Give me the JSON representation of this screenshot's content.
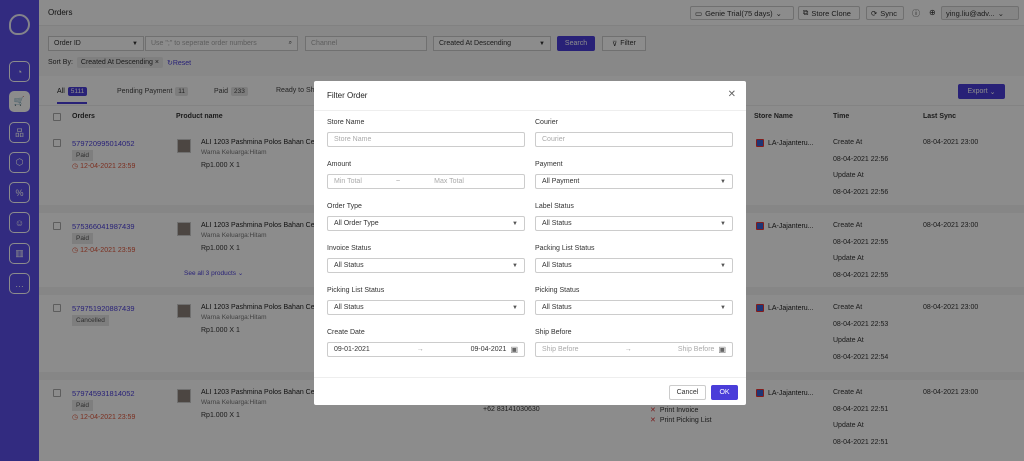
{
  "topbar": {
    "title": "Orders",
    "trial": "Genie Trial(75 days)",
    "store_clone": "Store Clone",
    "sync": "Sync",
    "user": "ying.liu@adv..."
  },
  "filterbar": {
    "search_type": "Order ID",
    "search_placeholder": "Use \";\" to seperate order numbers",
    "channel_placeholder": "Channel",
    "sort_select": "Created At Descending",
    "search_label": "Search",
    "filter_label": "Filter",
    "sort_by_label": "Sort By:",
    "sort_chip": "Created At Descending",
    "chip_close": "×",
    "reset_label": "Reset"
  },
  "tabs": [
    {
      "label": "All",
      "count": "5111"
    },
    {
      "label": "Pending Payment",
      "count": "11"
    },
    {
      "label": "Paid",
      "count": "233"
    },
    {
      "label": "Ready to Shi",
      "count": ""
    }
  ],
  "export_label": "Export",
  "table": {
    "headers": {
      "orders": "Orders",
      "product": "Product name",
      "store": "Store Name",
      "time": "Time",
      "last_sync": "Last Sync"
    },
    "rows": [
      {
        "order_id": "579720995014052",
        "status": "Paid",
        "deadline": "12-04-2021 23:59",
        "product": "ALI 1203 Pashmina Polos Bahan Cer...",
        "variant": "Warna Keluarga:Hitam",
        "price": "Rp1.000 X 1",
        "store": "LA-Jajanteru...",
        "create_label": "Create At",
        "create_at": "08-04-2021 22:56",
        "update_label": "Update At",
        "update_at": "08-04-2021 22:56",
        "last_sync": "08-04-2021 23:00"
      },
      {
        "order_id": "575366041987439",
        "status": "Paid",
        "deadline": "12-04-2021 23:59",
        "product": "ALI 1203 Pashmina Polos Bahan Cer...",
        "variant": "Warna Keluarga:Hitam",
        "price": "Rp1.000 X 1",
        "see_all": "See all 3 products",
        "store": "LA-Jajanteru...",
        "create_label": "Create At",
        "create_at": "08-04-2021 22:55",
        "update_label": "Update At",
        "update_at": "08-04-2021 22:55",
        "last_sync": "08-04-2021 23:00"
      },
      {
        "order_id": "579751920887439",
        "status": "Cancelled",
        "product": "ALI 1203 Pashmina Polos Bahan Cer...",
        "variant": "Warna Keluarga:Hitam",
        "price": "Rp1.000 X 1",
        "store": "LA-Jajanteru...",
        "create_label": "Create At",
        "create_at": "08-04-2021 22:53",
        "update_label": "Update At",
        "update_at": "08-04-2021 22:54",
        "last_sync": "08-04-2021 23:00"
      },
      {
        "order_id": "579745931814052",
        "status": "Paid",
        "deadline": "12-04-2021 23:59",
        "product": "ALI 1203 Pashmina Polos Bahan Cer...",
        "variant": "Warna Keluarga:Hitam",
        "price": "Rp1.000 X 1",
        "phone": "+62 83141030630",
        "print_invoice": "Print Invoice",
        "print_picking": "Print Picking List",
        "store": "LA-Jajanteru...",
        "create_label": "Create At",
        "create_at": "08-04-2021 22:51",
        "update_label": "Update At",
        "update_at": "08-04-2021 22:51",
        "last_sync": "08-04-2021 23:00"
      }
    ]
  },
  "modal": {
    "title": "Filter Order",
    "store_name_label": "Store Name",
    "store_name_placeholder": "Store Name",
    "courier_label": "Courier",
    "courier_placeholder": "Courier",
    "amount_label": "Amount",
    "min_placeholder": "Min Total",
    "max_placeholder": "Max Total",
    "range_sep": "~",
    "payment_label": "Payment",
    "payment_value": "All Payment",
    "order_type_label": "Order Type",
    "order_type_value": "All Order Type",
    "label_status_label": "Label Status",
    "label_status_value": "All Status",
    "invoice_status_label": "Invoice Status",
    "invoice_status_value": "All Status",
    "packing_list_label": "Packing List Status",
    "packing_list_value": "All Status",
    "picking_list_label": "Picking List Status",
    "picking_list_value": "All Status",
    "picking_status_label": "Picking Status",
    "picking_status_value": "All Status",
    "create_date_label": "Create Date",
    "create_date_from": "09-01-2021",
    "create_date_to": "09-04-2021",
    "date_arrow": "→",
    "ship_before_label": "Ship Before",
    "ship_before_from": "Ship Before",
    "ship_before_to": "Ship Before",
    "cancel_label": "Cancel",
    "ok_label": "OK"
  }
}
